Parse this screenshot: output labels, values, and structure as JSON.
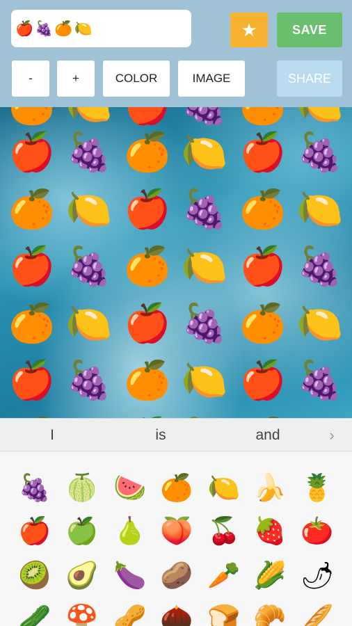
{
  "text_box": {
    "value": "🍎🍇🍊🍋"
  },
  "toolbar": {
    "star_label": "★",
    "save_label": "SAVE",
    "minus_label": "-",
    "plus_label": "+",
    "color_label": "COLOR",
    "image_label": "IMAGE",
    "share_label": "SHARE"
  },
  "canvas": {
    "background": "ocean-water",
    "rows": [
      [
        "🍊",
        "🍋",
        "🍎",
        "🍇",
        "🍊",
        "🍋"
      ],
      [
        "🍎",
        "🍇",
        "🍊",
        "🍋",
        "🍎",
        "🍇"
      ],
      [
        "🍊",
        "🍋",
        "🍎",
        "🍇",
        "🍊",
        "🍋"
      ],
      [
        "🍎",
        "🍇",
        "🍊",
        "🍋",
        "🍎",
        "🍇"
      ],
      [
        "🍊",
        "🍋",
        "🍎",
        "🍇",
        "🍊",
        "🍋"
      ],
      [
        "🍎",
        "🍇",
        "🍊",
        "🍋",
        "🍎",
        "🍇"
      ],
      [
        "🍊",
        "🍋",
        "🍎",
        "🍇",
        "🍊",
        "🍋"
      ]
    ]
  },
  "suggestions": {
    "items": [
      "I",
      "is",
      "and"
    ],
    "more_icon": "›"
  },
  "emoji_keyboard": {
    "rows": [
      [
        "🍇",
        "🍈",
        "🍉",
        "🍊",
        "🍋",
        "🍌",
        "🍍"
      ],
      [
        "🍎",
        "🍏",
        "🍐",
        "🍑",
        "🍒",
        "🍓",
        "🍅"
      ],
      [
        "🥝",
        "🥑",
        "🍆",
        "🥔",
        "🥕",
        "🌽",
        "🌶"
      ],
      [
        "🥒",
        "🍄",
        "🥜",
        "🌰",
        "🍞",
        "🥐",
        "🥖"
      ]
    ]
  }
}
